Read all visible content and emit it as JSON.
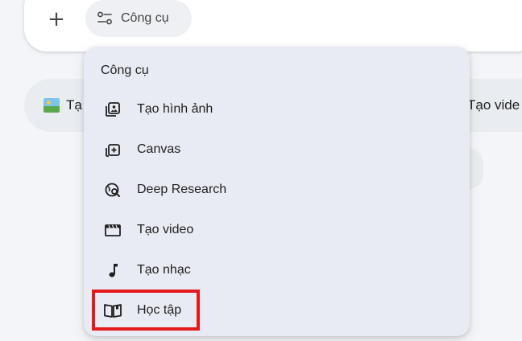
{
  "composer": {
    "plus_label": "+",
    "tools_label": "Công cụ"
  },
  "background_chips": {
    "left_label": "Tạ",
    "right_label": "Tạo vide"
  },
  "menu": {
    "title": "Công cụ",
    "items": [
      {
        "label": "Tạo hình ảnh",
        "icon": "image-stack-icon"
      },
      {
        "label": "Canvas",
        "icon": "canvas-icon"
      },
      {
        "label": "Deep Research",
        "icon": "deep-research-icon"
      },
      {
        "label": "Tạo video",
        "icon": "video-clapper-icon"
      },
      {
        "label": "Tạo nhạc",
        "icon": "music-note-icon"
      },
      {
        "label": "Học tập",
        "icon": "open-book-icon"
      }
    ],
    "highlighted_item": "Học tập"
  },
  "colors": {
    "page_bg": "#f3f5f8",
    "menu_bg": "#e8ebf3",
    "highlight": "#e5191c",
    "icon": "#1f1f1f"
  }
}
